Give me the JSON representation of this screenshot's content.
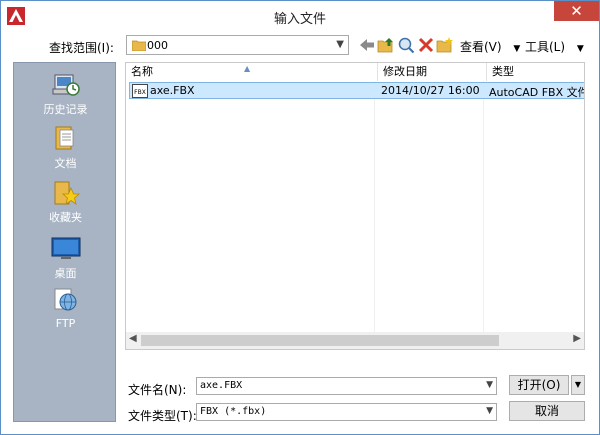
{
  "window": {
    "title": "输入文件",
    "close_glyph": "✕",
    "app_icon": "autocad-logo-icon",
    "accent_color": "#c7463c"
  },
  "lookin": {
    "label": "查找范围(I):",
    "value": "000"
  },
  "toolbar": {
    "view_label": "查看(V)",
    "tools_label": "工具(L)",
    "icons": [
      "back-arrow-icon",
      "up-folder-icon",
      "search-web-icon",
      "delete-icon",
      "new-folder-icon"
    ]
  },
  "places": [
    {
      "label": "历史记录",
      "icon": "history-icon"
    },
    {
      "label": "文档",
      "icon": "documents-icon"
    },
    {
      "label": "收藏夹",
      "icon": "favorites-icon"
    },
    {
      "label": "桌面",
      "icon": "desktop-icon"
    },
    {
      "label": "FTP",
      "icon": "ftp-icon"
    }
  ],
  "filelist": {
    "columns": [
      "名称",
      "修改日期",
      "类型"
    ],
    "rows": [
      {
        "name": "axe.FBX",
        "date": "2014/10/27 16:00",
        "type": "AutoCAD FBX 文件"
      }
    ],
    "file_icon_text": "FBX"
  },
  "filename": {
    "label": "文件名(N):",
    "value": "axe.FBX"
  },
  "filetype": {
    "label": "文件类型(T):",
    "value": "FBX (*.fbx)"
  },
  "buttons": {
    "open": "打开(O)",
    "cancel": "取消"
  }
}
